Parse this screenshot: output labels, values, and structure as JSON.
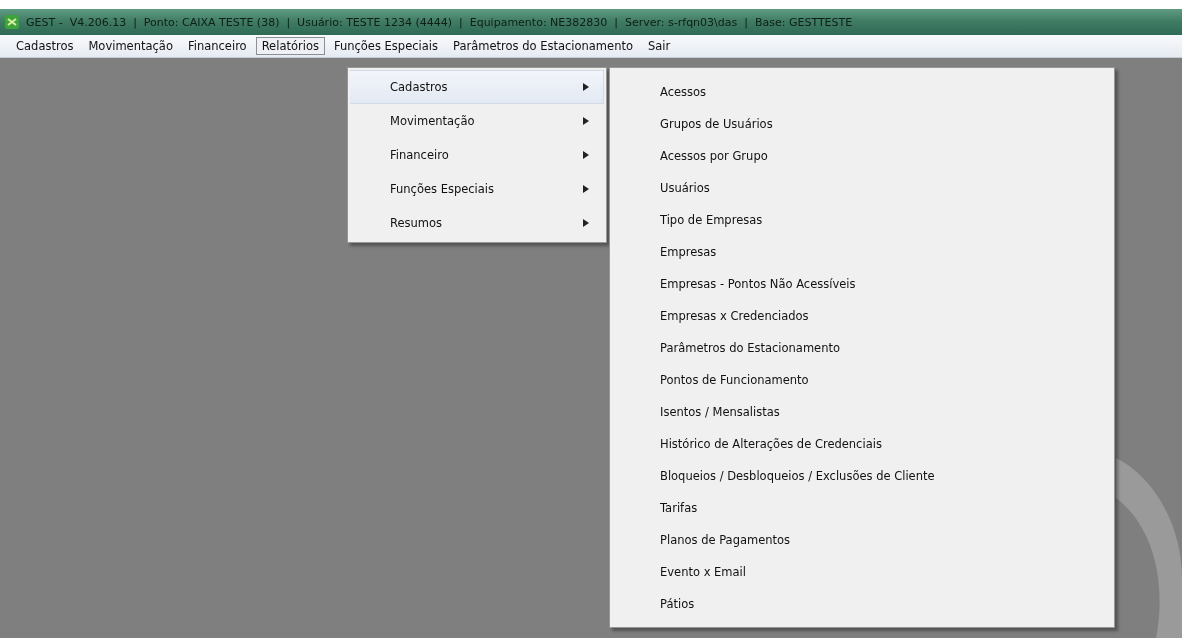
{
  "window": {
    "title": "GEST -  V4.206.13  |  Ponto: CAIXA TESTE (38)  |  Usuário: TESTE 1234 (4444)  |  Equipamento: NE382830  |  Server: s-rfqn03\\das  |  Base: GESTTESTE"
  },
  "menu_bar": [
    {
      "label": "Cadastros",
      "selected": false
    },
    {
      "label": "Movimentação",
      "selected": false
    },
    {
      "label": "Financeiro",
      "selected": false
    },
    {
      "label": "Relatórios",
      "selected": true
    },
    {
      "label": "Funções Especiais",
      "selected": false
    },
    {
      "label": "Parâmetros do Estacionamento",
      "selected": false
    },
    {
      "label": "Sair",
      "selected": false
    }
  ],
  "dropdown": [
    {
      "label": "Cadastros",
      "selected": true
    },
    {
      "label": "Movimentação",
      "selected": false
    },
    {
      "label": "Financeiro",
      "selected": false
    },
    {
      "label": "Funções Especiais",
      "selected": false
    },
    {
      "label": "Resumos",
      "selected": false
    }
  ],
  "submenu": [
    "Acessos",
    "Grupos de Usuários",
    "Acessos por Grupo",
    "Usuários",
    "Tipo de Empresas",
    "Empresas",
    "Empresas - Pontos Não Acessíveis",
    "Empresas x Credenciados",
    "Parâmetros do Estacionamento",
    "Pontos de Funcionamento",
    "Isentos / Mensalistas",
    "Histórico de Alterações de Credenciais",
    "Bloqueios / Desbloqueios / Exclusões de Cliente",
    "Tarifas",
    "Planos de Pagamentos",
    "Evento x Email",
    "Pátios"
  ]
}
